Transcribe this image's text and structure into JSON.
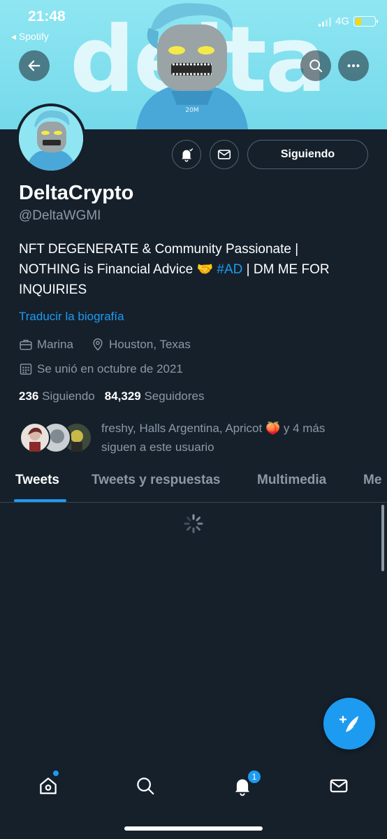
{
  "status_bar": {
    "time": "21:48",
    "back_app": "◂ Spotify",
    "network": "4G",
    "battery_level": 0.3
  },
  "banner": {
    "word": "delta",
    "character_label": "20M",
    "bg_color": "#8fe6f2"
  },
  "profile": {
    "name": "DeltaCrypto",
    "handle": "@DeltaWGMI",
    "bio_line1": "NFT DEGENERATE & Community Passionate |",
    "bio_line2_a": "NOTHING is Financial Advice 🤝",
    "bio_hashtag": "#AD",
    "bio_line2_b": "| DM ME FOR",
    "bio_line3": "INQUIRIES",
    "translate_label": "Traducir la biografía",
    "work": "Marina",
    "location": "Houston, Texas",
    "joined": "Se unió en octubre de 2021",
    "following_count": "236",
    "following_label": "Siguiendo",
    "followers_count": "84,329",
    "followers_label": "Seguidores",
    "followed_by_text": "freshy, Halls Argentina, Apricot 🍑 y 4 más sigue a este usuario",
    "followed_by_line1": "freshy, Halls Argentina, Apricot 🍑 y 4 más",
    "followed_by_line2": "siguen a este usuario"
  },
  "actions": {
    "follow_label": "Siguiendo",
    "notify_icon": "bell-check-icon",
    "message_icon": "envelope-icon"
  },
  "tabs": [
    {
      "label": "Tweets"
    },
    {
      "label": "Tweets y respuestas"
    },
    {
      "label": "Multimedia"
    },
    {
      "label": "Me"
    }
  ],
  "bottom_nav": {
    "notifications_badge": "1"
  },
  "colors": {
    "accent": "#1d9bf0",
    "background": "#15202b",
    "muted": "#8b98a5"
  }
}
